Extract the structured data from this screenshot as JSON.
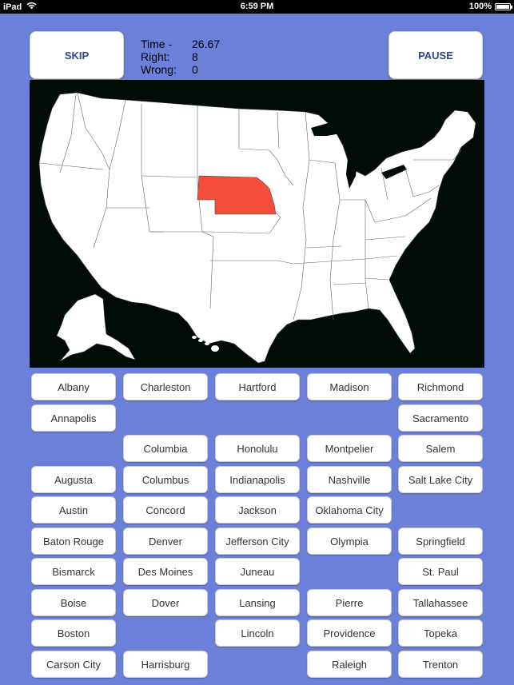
{
  "status_bar": {
    "device": "iPad",
    "time": "6:59 PM",
    "battery": "100%"
  },
  "buttons": {
    "skip": "SKIP",
    "pause": "PAUSE"
  },
  "stats": [
    {
      "label": "Time -",
      "value": "26.67"
    },
    {
      "label": "Right:",
      "value": "8"
    },
    {
      "label": "Wrong:",
      "value": "0"
    }
  ],
  "map": {
    "highlight_color": "#f44e3b",
    "land_color": "#ffffff",
    "background_color": "#020c06"
  },
  "cities": {
    "col1": [
      "Albany",
      "Annapolis",
      "",
      "Augusta",
      "Austin",
      "Baton Rouge",
      "Bismarck",
      "Boise",
      "Boston",
      "Carson City"
    ],
    "col2": [
      "Charleston",
      "",
      "Columbia",
      "Columbus",
      "Concord",
      "Denver",
      "Des Moines",
      "Dover",
      "",
      "Harrisburg"
    ],
    "col3": [
      "Hartford",
      "",
      "Honolulu",
      "Indianapolis",
      "Jackson",
      "Jefferson City",
      "Juneau",
      "Lansing",
      "Lincoln",
      ""
    ],
    "col4": [
      "Madison",
      "",
      "Montpelier",
      "Nashville",
      "Oklahoma City",
      "Olympia",
      "",
      "Pierre",
      "Providence",
      "Raleigh"
    ],
    "col5": [
      "Richmond",
      "Sacramento",
      "Salem",
      "Salt Lake City",
      "",
      "Springfield",
      "St. Paul",
      "Tallahassee",
      "Topeka",
      "Trenton"
    ]
  }
}
